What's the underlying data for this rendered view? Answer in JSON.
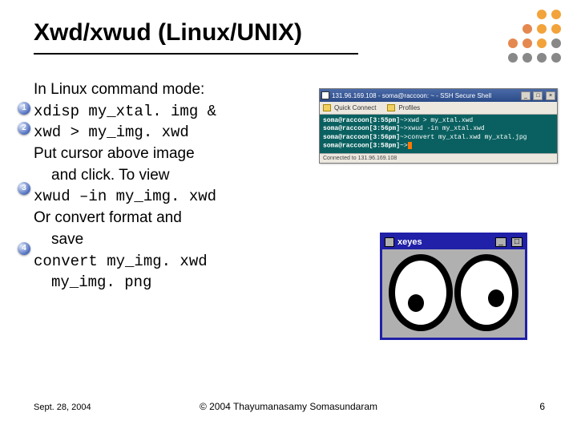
{
  "title": "Xwd/xwud (Linux/UNIX)",
  "decorationDots": {
    "pattern": [
      [
        null,
        null,
        "#f2a33a",
        "#f2a33a"
      ],
      [
        null,
        "#e5884f",
        "#f2a33a",
        "#f2a33a"
      ],
      [
        "#e5884f",
        "#e5884f",
        "#f2a33a",
        "#888888"
      ],
      [
        "#888888",
        "#888888",
        "#888888",
        "#888888"
      ]
    ]
  },
  "bulletNumbers": [
    "1",
    "2",
    "3",
    "4"
  ],
  "body": {
    "line1": "In Linux command mode:",
    "cmd1": "xdisp my_xtal. img &",
    "cmd2": "xwd > my_img. xwd",
    "line2a": "Put cursor above image",
    "line2b": "and click.  To view",
    "cmd3": "xwud –in my_img. xwd",
    "line3a": "Or convert format and",
    "line3b": "save",
    "cmd4a": "convert my_img. xwd",
    "cmd4b": "my_img. png"
  },
  "terminal": {
    "title": "131.96.169.108 - soma@raccoon: ~ - SSH Secure Shell",
    "toolbar": [
      "Quick Connect",
      "Profiles"
    ],
    "lines": [
      {
        "prompt": "soma@raccoon[3:55pm]",
        "cmd": "~>xwd > my_xtal.xwd"
      },
      {
        "prompt": "soma@raccoon[3:56pm]",
        "cmd": "~>xwud -in my_xtal.xwd"
      },
      {
        "prompt": "soma@raccoon[3:56pm]",
        "cmd": "~>convert my_xtal.xwd my_xtal.jpg"
      },
      {
        "prompt": "soma@raccoon[3:58pm]",
        "cmd": "~>"
      }
    ],
    "status": "Connected to 131.96.169.108"
  },
  "xeyes": {
    "title": "xeyes",
    "buttons": {
      "min": "_",
      "max": "□"
    }
  },
  "footer": {
    "date": "Sept. 28, 2004",
    "copyright": "© 2004 Thayumanasamy Somasundaram",
    "page": "6"
  }
}
